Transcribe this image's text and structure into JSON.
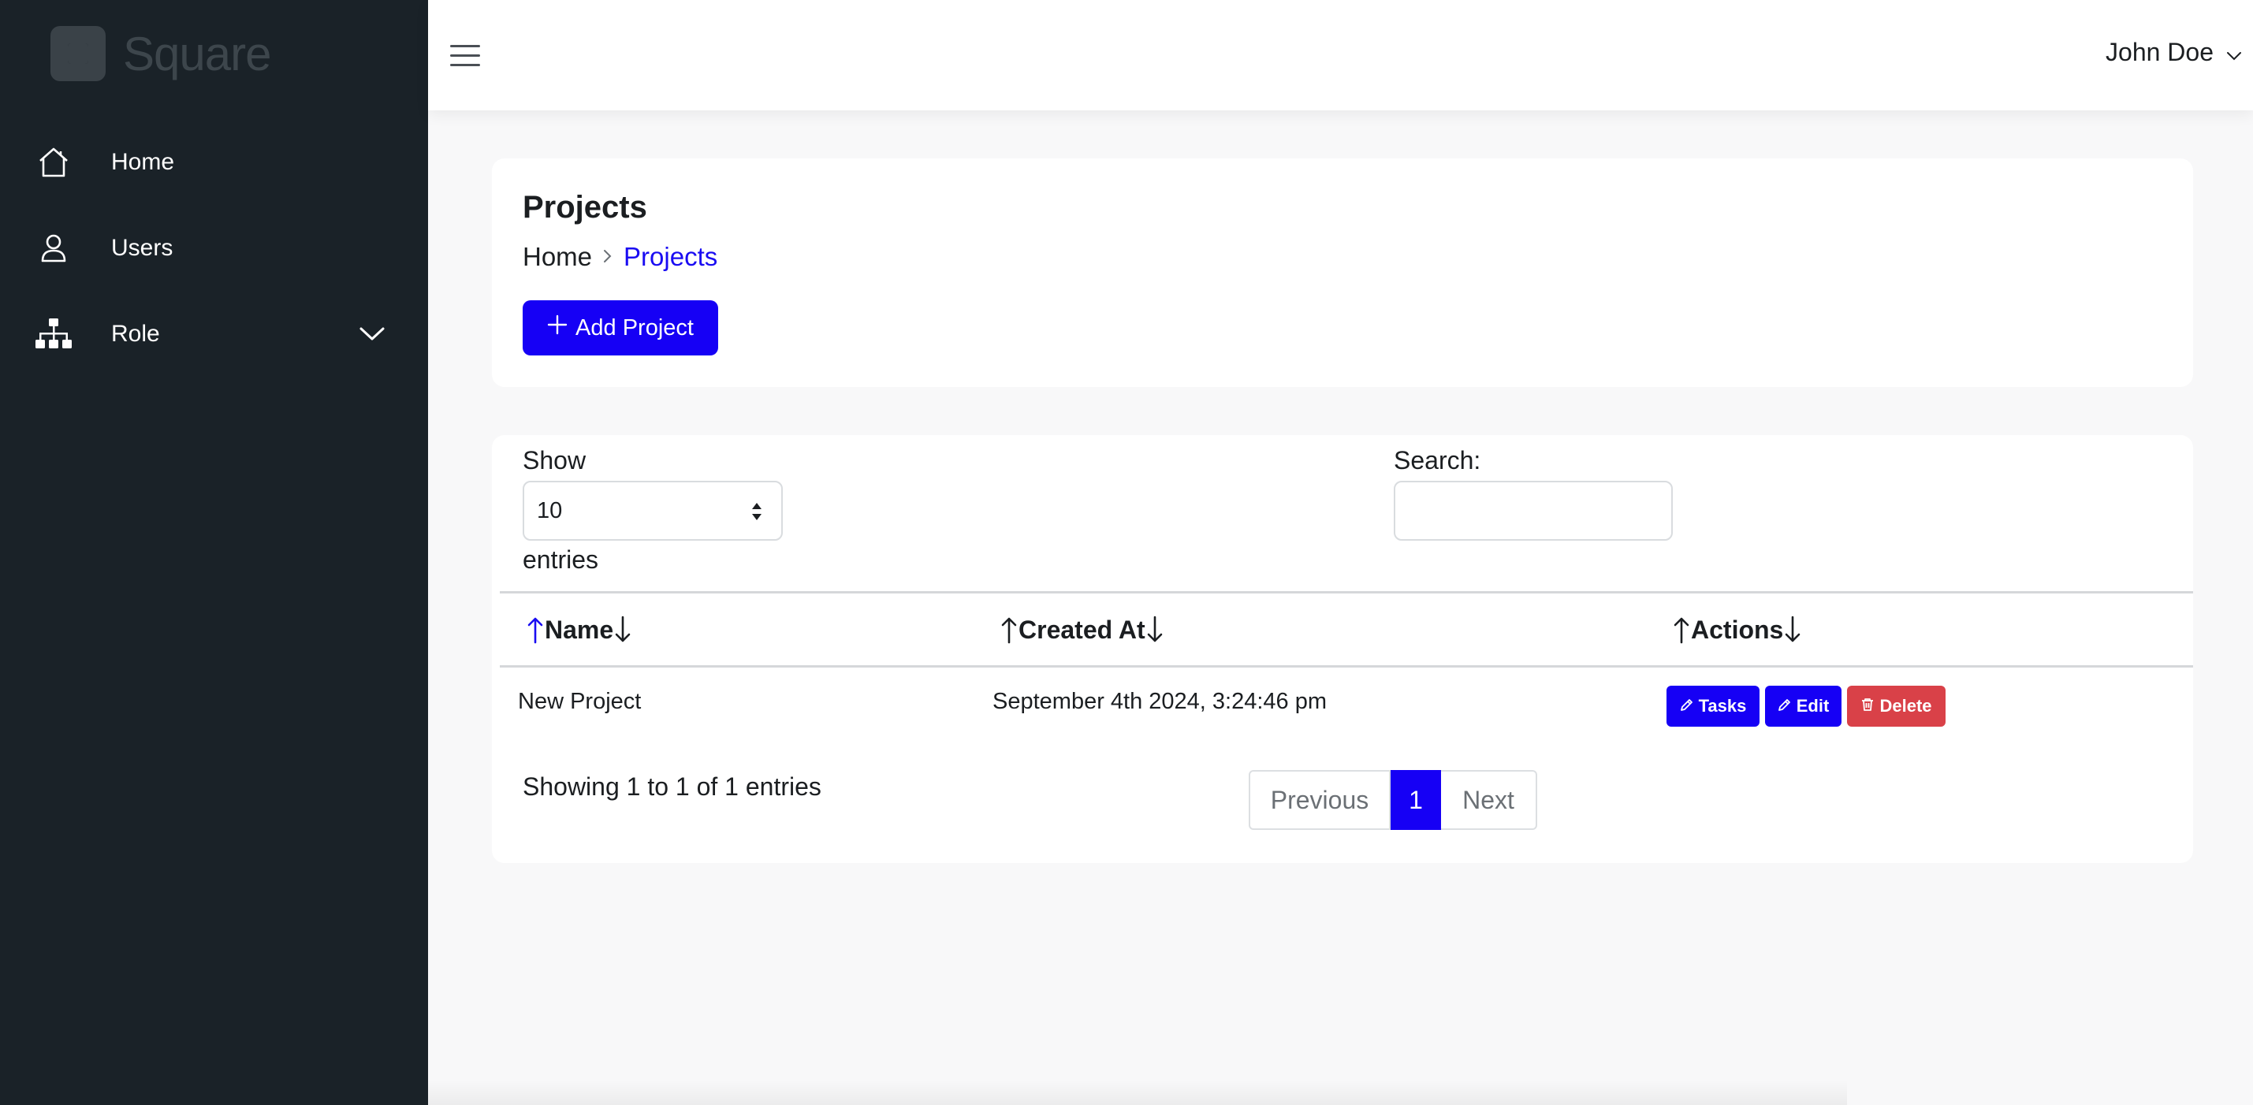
{
  "brand": {
    "name": "Square"
  },
  "sidebar": {
    "items": [
      {
        "label": "Home",
        "icon": "home-icon"
      },
      {
        "label": "Users",
        "icon": "user-icon"
      },
      {
        "label": "Role",
        "icon": "sitemap-icon",
        "expandable": true
      }
    ]
  },
  "topbar": {
    "user_name": "John Doe"
  },
  "page": {
    "title": "Projects",
    "breadcrumb": {
      "home": "Home",
      "current": "Projects"
    },
    "add_button": "Add Project"
  },
  "table_controls": {
    "show_label": "Show",
    "page_length": "10",
    "entries_label": "entries",
    "search_label": "Search:",
    "search_value": ""
  },
  "table": {
    "columns": [
      "Name",
      "Created At",
      "Actions"
    ],
    "rows": [
      {
        "name": "New Project",
        "created_at": "September 4th 2024, 3:24:46 pm"
      }
    ],
    "actions": {
      "tasks": "Tasks",
      "edit": "Edit",
      "delete": "Delete"
    }
  },
  "footer": {
    "info": "Showing 1 to 1 of 1 entries",
    "pagination": {
      "previous": "Previous",
      "current": "1",
      "next": "Next"
    }
  },
  "colors": {
    "primary": "#1600f5",
    "danger": "#d94148",
    "sidebar_bg": "#1a2228",
    "sort_active": "#1a0cf2"
  }
}
